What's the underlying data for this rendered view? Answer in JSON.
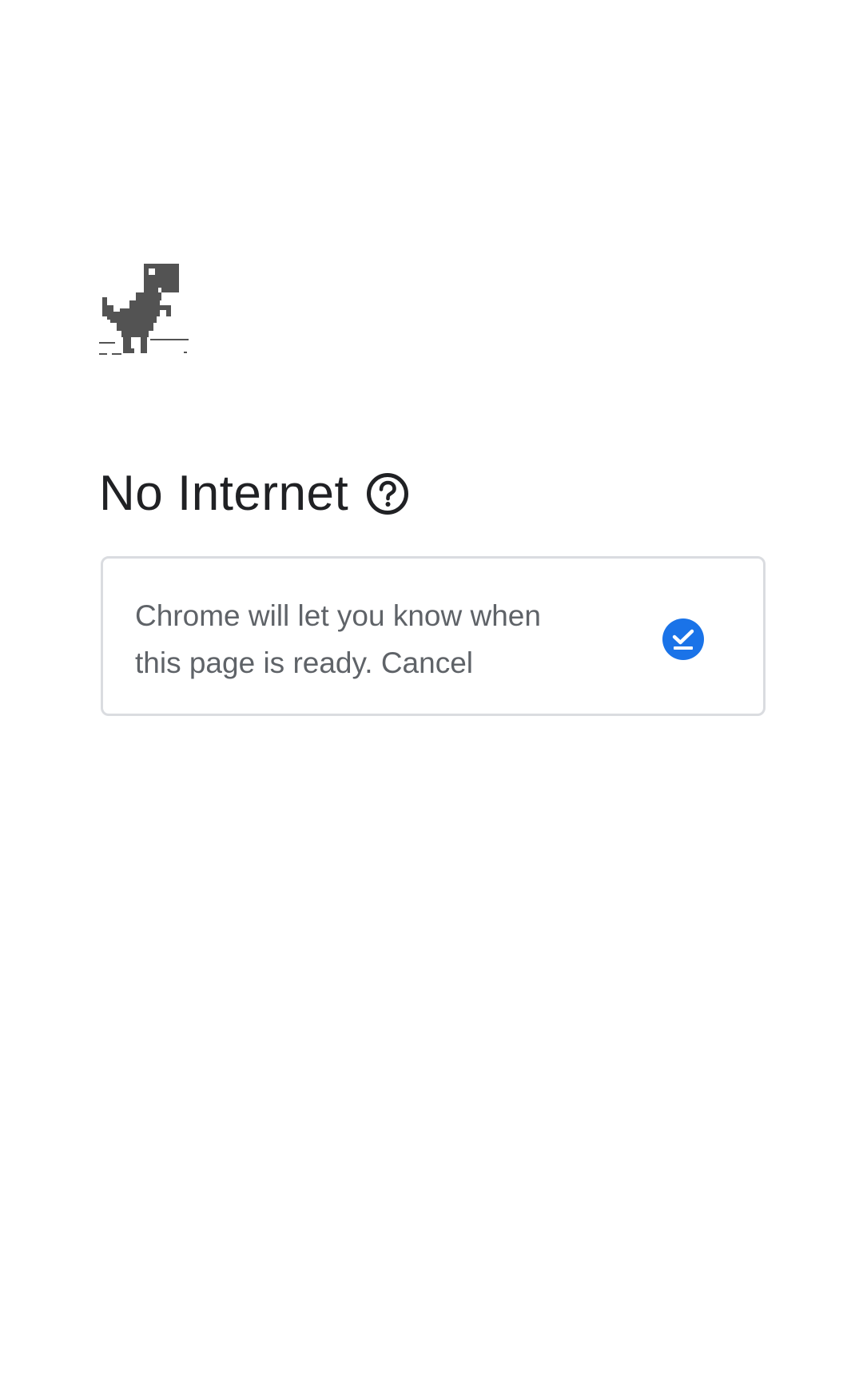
{
  "page": {
    "title": "No Internet",
    "help_icon": "help-circle-icon",
    "dino_icon": "offline-dinosaur-icon"
  },
  "notification_card": {
    "message": "Chrome will let you know when this page is ready.",
    "cancel_label": "Cancel",
    "status_icon": "download-check-icon",
    "accent_color": "#1a73e8"
  },
  "colors": {
    "title_text": "#202124",
    "body_text": "#5f6368",
    "card_border": "#dadce0",
    "dino": "#535353"
  }
}
